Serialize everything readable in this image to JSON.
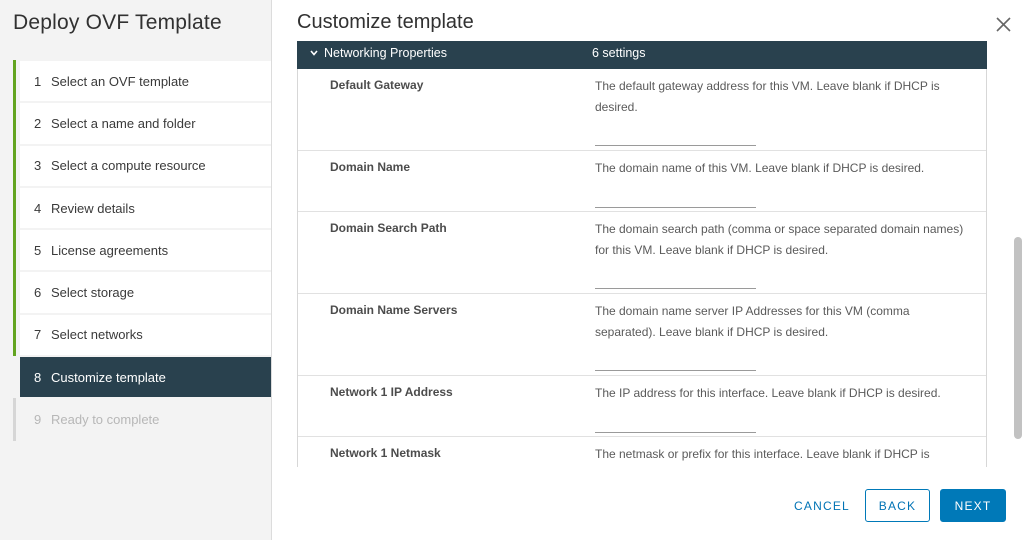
{
  "wizard": {
    "title": "Deploy OVF Template",
    "steps": [
      {
        "num": "1",
        "label": "Select an OVF template",
        "state": "completed"
      },
      {
        "num": "2",
        "label": "Select a name and folder",
        "state": "completed"
      },
      {
        "num": "3",
        "label": "Select a compute resource",
        "state": "completed"
      },
      {
        "num": "4",
        "label": "Review details",
        "state": "completed"
      },
      {
        "num": "5",
        "label": "License agreements",
        "state": "completed"
      },
      {
        "num": "6",
        "label": "Select storage",
        "state": "completed"
      },
      {
        "num": "7",
        "label": "Select networks",
        "state": "completed"
      },
      {
        "num": "8",
        "label": "Customize template",
        "state": "active"
      },
      {
        "num": "9",
        "label": "Ready to complete",
        "state": "pending"
      }
    ]
  },
  "main": {
    "title": "Customize template",
    "close_icon": "close-icon",
    "section": {
      "name": "Networking Properties",
      "count": "6 settings",
      "expanded": true,
      "properties": [
        {
          "label": "Default Gateway",
          "description": "The default gateway address for this VM. Leave blank if DHCP is desired.",
          "value": ""
        },
        {
          "label": "Domain Name",
          "description": "The domain name of this VM. Leave blank if DHCP is desired.",
          "value": ""
        },
        {
          "label": "Domain Search Path",
          "description": "The domain search path (comma or space separated domain names) for this VM. Leave blank if DHCP is desired.",
          "value": ""
        },
        {
          "label": "Domain Name Servers",
          "description": "The domain name server IP Addresses for this VM (comma separated). Leave blank if DHCP is desired.",
          "value": ""
        },
        {
          "label": "Network 1 IP Address",
          "description": "The IP address for this interface. Leave blank if DHCP is desired.",
          "value": ""
        },
        {
          "label": "Network 1 Netmask",
          "description": "The netmask or prefix for this interface. Leave blank if DHCP is desired.",
          "value": ""
        }
      ]
    }
  },
  "footer": {
    "cancel_label": "CANCEL",
    "back_label": "BACK",
    "next_label": "NEXT"
  },
  "colors": {
    "accent": "#0079b8",
    "header_dark": "#29414e",
    "progress_green": "#62a420"
  }
}
